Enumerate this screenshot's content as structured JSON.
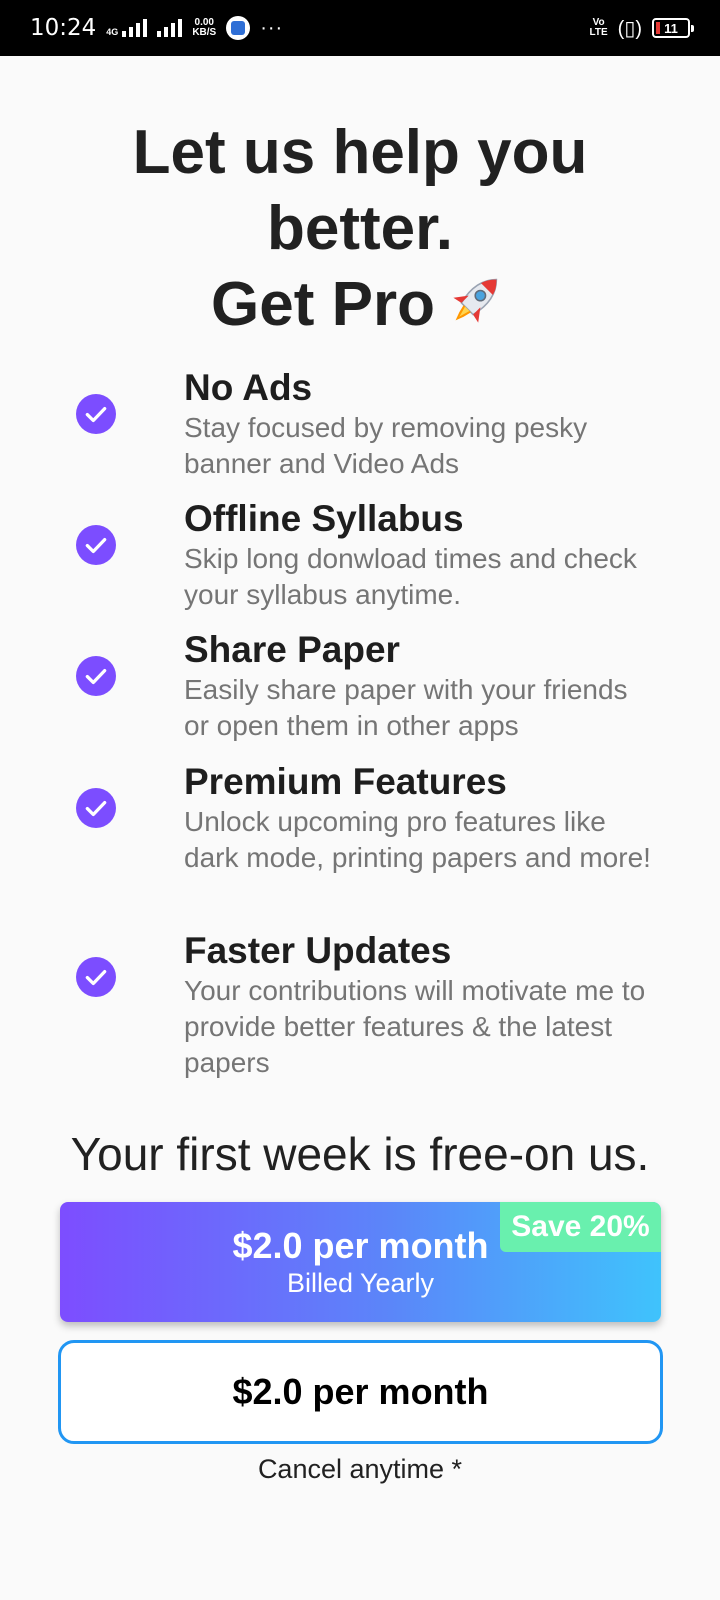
{
  "status_bar": {
    "time": "10:24",
    "network_label": "4G",
    "speed_value": "0.00",
    "speed_unit": "KB/S",
    "more": "···",
    "volte_top": "Vo",
    "volte_bottom": "LTE",
    "battery_level": "11"
  },
  "title": {
    "line1": "Let us help you",
    "line2": "better.",
    "line3": "Get Pro",
    "emoji_icon": "rocket-icon"
  },
  "features": [
    {
      "title": "No Ads",
      "description": "Stay focused by removing pesky banner and Video Ads"
    },
    {
      "title": "Offline Syllabus",
      "description": "Skip long donwload times and check your syllabus anytime."
    },
    {
      "title": "Share Paper",
      "description": "Easily share paper with your friends or open them in other apps"
    },
    {
      "title": "Premium Features",
      "description": "Unlock upcoming pro features like dark mode, printing papers and more!"
    },
    {
      "title": "Faster Updates",
      "description": "Your contributions will motivate me to provide better features & the latest papers"
    }
  ],
  "free_week_text": "Your first week is free-on us.",
  "plans": {
    "yearly": {
      "price": "$2.0 per month",
      "billing": "Billed Yearly",
      "badge": "Save 20%"
    },
    "monthly": {
      "price": "$2.0 per month"
    }
  },
  "cancel_text": "Cancel anytime *",
  "colors": {
    "accent": "#7c4dff",
    "gradient_start": "#7d4dff",
    "gradient_end": "#3fc3fc",
    "badge": "#69f0ae",
    "outline": "#2196f3"
  }
}
